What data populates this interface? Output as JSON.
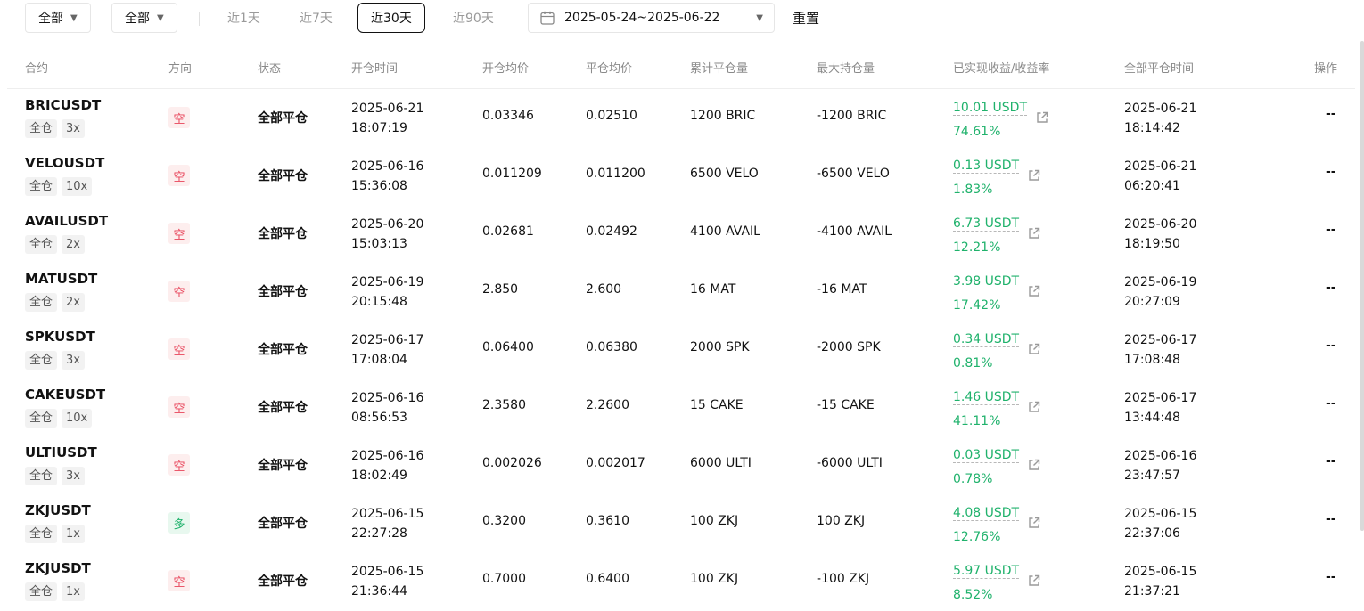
{
  "filters": {
    "dropdown1": "全部",
    "dropdown2": "全部",
    "ranges": [
      "近1天",
      "近7天",
      "近30天",
      "近90天"
    ],
    "active_range": "近30天",
    "date_range": "2025-05-24~2025-06-22",
    "reset_label": "重置"
  },
  "columns": {
    "symbol": "合约",
    "side": "方向",
    "status": "状态",
    "open_time": "开仓时间",
    "open_avg": "开仓均价",
    "close_avg": "平仓均价",
    "closed_qty": "累计平仓量",
    "max_pos": "最大持仓量",
    "pnl": "已实现收益/收益率",
    "close_time": "全部平仓时间",
    "action": "操作"
  },
  "colors": {
    "profit": "#20b26c",
    "short": "#e8445a",
    "long": "#20b26c"
  },
  "rows": [
    {
      "symbol": "BRICUSDT",
      "margin": "全仓",
      "leverage": "3x",
      "side": "空",
      "side_type": "short",
      "status": "全部平仓",
      "open_date": "2025-06-21",
      "open_clock": "18:07:19",
      "open_avg": "0.03346",
      "close_avg": "0.02510",
      "closed_qty": "1200 BRIC",
      "max_pos": "-1200 BRIC",
      "pnl": "10.01 USDT",
      "pnl_rate": "74.61%",
      "close_date": "2025-06-21",
      "close_clock": "18:14:42",
      "action": "--"
    },
    {
      "symbol": "VELOUSDT",
      "margin": "全仓",
      "leverage": "10x",
      "side": "空",
      "side_type": "short",
      "status": "全部平仓",
      "open_date": "2025-06-16",
      "open_clock": "15:36:08",
      "open_avg": "0.011209",
      "close_avg": "0.011200",
      "closed_qty": "6500 VELO",
      "max_pos": "-6500 VELO",
      "pnl": "0.13 USDT",
      "pnl_rate": "1.83%",
      "close_date": "2025-06-21",
      "close_clock": "06:20:41",
      "action": "--"
    },
    {
      "symbol": "AVAILUSDT",
      "margin": "全仓",
      "leverage": "2x",
      "side": "空",
      "side_type": "short",
      "status": "全部平仓",
      "open_date": "2025-06-20",
      "open_clock": "15:03:13",
      "open_avg": "0.02681",
      "close_avg": "0.02492",
      "closed_qty": "4100 AVAIL",
      "max_pos": "-4100 AVAIL",
      "pnl": "6.73 USDT",
      "pnl_rate": "12.21%",
      "close_date": "2025-06-20",
      "close_clock": "18:19:50",
      "action": "--"
    },
    {
      "symbol": "MATUSDT",
      "margin": "全仓",
      "leverage": "2x",
      "side": "空",
      "side_type": "short",
      "status": "全部平仓",
      "open_date": "2025-06-19",
      "open_clock": "20:15:48",
      "open_avg": "2.850",
      "close_avg": "2.600",
      "closed_qty": "16 MAT",
      "max_pos": "-16 MAT",
      "pnl": "3.98 USDT",
      "pnl_rate": "17.42%",
      "close_date": "2025-06-19",
      "close_clock": "20:27:09",
      "action": "--"
    },
    {
      "symbol": "SPKUSDT",
      "margin": "全仓",
      "leverage": "3x",
      "side": "空",
      "side_type": "short",
      "status": "全部平仓",
      "open_date": "2025-06-17",
      "open_clock": "17:08:04",
      "open_avg": "0.06400",
      "close_avg": "0.06380",
      "closed_qty": "2000 SPK",
      "max_pos": "-2000 SPK",
      "pnl": "0.34 USDT",
      "pnl_rate": "0.81%",
      "close_date": "2025-06-17",
      "close_clock": "17:08:48",
      "action": "--"
    },
    {
      "symbol": "CAKEUSDT",
      "margin": "全仓",
      "leverage": "10x",
      "side": "空",
      "side_type": "short",
      "status": "全部平仓",
      "open_date": "2025-06-16",
      "open_clock": "08:56:53",
      "open_avg": "2.3580",
      "close_avg": "2.2600",
      "closed_qty": "15 CAKE",
      "max_pos": "-15 CAKE",
      "pnl": "1.46 USDT",
      "pnl_rate": "41.11%",
      "close_date": "2025-06-17",
      "close_clock": "13:44:48",
      "action": "--"
    },
    {
      "symbol": "ULTIUSDT",
      "margin": "全仓",
      "leverage": "3x",
      "side": "空",
      "side_type": "short",
      "status": "全部平仓",
      "open_date": "2025-06-16",
      "open_clock": "18:02:49",
      "open_avg": "0.002026",
      "close_avg": "0.002017",
      "closed_qty": "6000 ULTI",
      "max_pos": "-6000 ULTI",
      "pnl": "0.03 USDT",
      "pnl_rate": "0.78%",
      "close_date": "2025-06-16",
      "close_clock": "23:47:57",
      "action": "--"
    },
    {
      "symbol": "ZKJUSDT",
      "margin": "全仓",
      "leverage": "1x",
      "side": "多",
      "side_type": "long",
      "status": "全部平仓",
      "open_date": "2025-06-15",
      "open_clock": "22:27:28",
      "open_avg": "0.3200",
      "close_avg": "0.3610",
      "closed_qty": "100 ZKJ",
      "max_pos": "100 ZKJ",
      "pnl": "4.08 USDT",
      "pnl_rate": "12.76%",
      "close_date": "2025-06-15",
      "close_clock": "22:37:06",
      "action": "--"
    },
    {
      "symbol": "ZKJUSDT",
      "margin": "全仓",
      "leverage": "1x",
      "side": "空",
      "side_type": "short",
      "status": "全部平仓",
      "open_date": "2025-06-15",
      "open_clock": "21:36:44",
      "open_avg": "0.7000",
      "close_avg": "0.6400",
      "closed_qty": "100 ZKJ",
      "max_pos": "-100 ZKJ",
      "pnl": "5.97 USDT",
      "pnl_rate": "8.52%",
      "close_date": "2025-06-15",
      "close_clock": "21:37:21",
      "action": "--"
    }
  ]
}
